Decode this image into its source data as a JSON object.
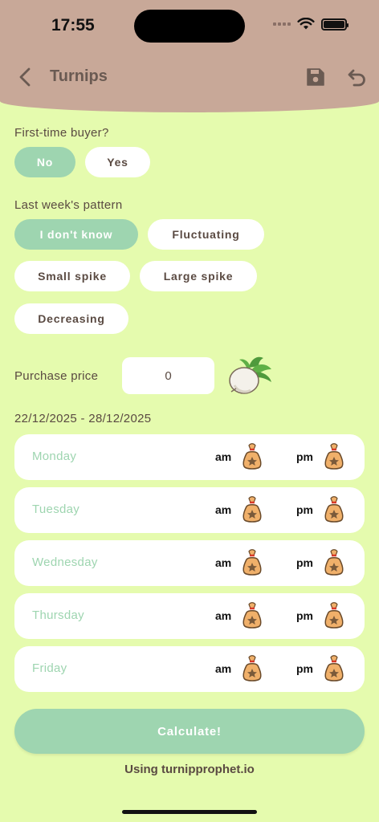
{
  "status": {
    "time": "17:55"
  },
  "nav": {
    "title": "Turnips"
  },
  "first_time": {
    "label": "First-time buyer?",
    "options": [
      {
        "label": "No",
        "selected": true
      },
      {
        "label": "Yes",
        "selected": false
      }
    ]
  },
  "pattern": {
    "label": "Last week's pattern",
    "options": [
      {
        "label": "I don't know",
        "selected": true
      },
      {
        "label": "Fluctuating",
        "selected": false
      },
      {
        "label": "Small spike",
        "selected": false
      },
      {
        "label": "Large spike",
        "selected": false
      },
      {
        "label": "Decreasing",
        "selected": false
      }
    ]
  },
  "purchase": {
    "label": "Purchase price",
    "value": "0"
  },
  "week": {
    "range": "22/12/2025 - 28/12/2025",
    "am_label": "am",
    "pm_label": "pm",
    "days": [
      {
        "name": "Monday"
      },
      {
        "name": "Tuesday"
      },
      {
        "name": "Wednesday"
      },
      {
        "name": "Thursday"
      },
      {
        "name": "Friday"
      }
    ]
  },
  "calculate": {
    "label": "Calculate!"
  },
  "footer": {
    "note": "Using turnipprophet.io"
  },
  "colors": {
    "background": "#e5fbae",
    "header": "#c8a898",
    "accent": "#9ed5b0",
    "text": "#5a4a42"
  }
}
